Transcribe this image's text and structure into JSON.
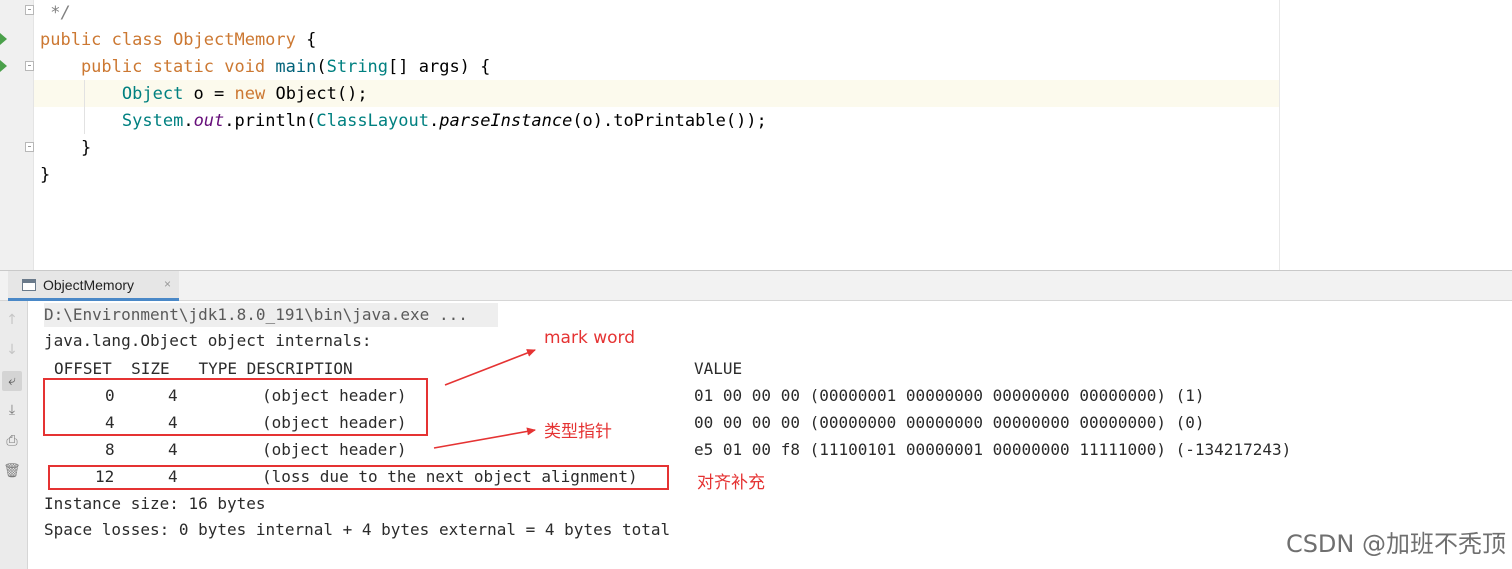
{
  "editor": {
    "lines": [
      {
        "segments": [
          {
            "t": " */",
            "c": "cmt"
          }
        ]
      },
      {
        "segments": [
          {
            "t": "public class ",
            "c": "orange"
          },
          {
            "t": "ObjectMemory",
            "c": "orange"
          },
          {
            "t": " {",
            "c": ""
          }
        ]
      },
      {
        "segments": [
          {
            "t": "    public static void ",
            "c": "orange"
          },
          {
            "t": "main",
            "c": "fn"
          },
          {
            "t": "(",
            "c": ""
          },
          {
            "t": "String",
            "c": "cls"
          },
          {
            "t": "[] args) {",
            "c": ""
          }
        ]
      },
      {
        "segments": [
          {
            "t": "        ",
            "c": ""
          },
          {
            "t": "Object",
            "c": "cls"
          },
          {
            "t": " o = ",
            "c": ""
          },
          {
            "t": "new ",
            "c": "orange"
          },
          {
            "t": "Object();",
            "c": ""
          }
        ]
      },
      {
        "segments": [
          {
            "t": "        ",
            "c": ""
          },
          {
            "t": "System",
            "c": "cls"
          },
          {
            "t": ".",
            "c": ""
          },
          {
            "t": "out",
            "c": "it"
          },
          {
            "t": ".println(",
            "c": ""
          },
          {
            "t": "ClassLayout",
            "c": "cls"
          },
          {
            "t": ".",
            "c": ""
          },
          {
            "t": "parseInstance",
            "c": "it2"
          },
          {
            "t": "(o).toPrintable());",
            "c": ""
          }
        ]
      },
      {
        "segments": [
          {
            "t": "    }",
            "c": ""
          }
        ]
      },
      {
        "segments": [
          {
            "t": "}",
            "c": ""
          }
        ]
      }
    ]
  },
  "run_panel": {
    "tab_label": "ObjectMemory",
    "tab_close": "×",
    "toolbar": [
      {
        "name": "up-arrow-icon",
        "glyph": "↑"
      },
      {
        "name": "down-arrow-icon",
        "glyph": "↓"
      },
      {
        "name": "soft-wrap-icon",
        "glyph": "⤶"
      },
      {
        "name": "scroll-to-end-icon",
        "glyph": "⤓"
      },
      {
        "name": "print-icon",
        "glyph": "⎙"
      },
      {
        "name": "trash-icon",
        "glyph": "🗑"
      }
    ]
  },
  "console": {
    "command": "D:\\Environment\\jdk1.8.0_191\\bin\\java.exe ...",
    "header_line": "java.lang.Object object internals:",
    "columns": "OFFSET  SIZE   TYPE DESCRIPTION",
    "value_header": "VALUE",
    "rows": [
      {
        "offset": "0",
        "size": "4",
        "desc": "(object header)",
        "value": "01 00 00 00 (00000001 00000000 00000000 00000000) (1)"
      },
      {
        "offset": "4",
        "size": "4",
        "desc": "(object header)",
        "value": "00 00 00 00 (00000000 00000000 00000000 00000000) (0)"
      },
      {
        "offset": "8",
        "size": "4",
        "desc": "(object header)",
        "value": "e5 01 00 f8 (11100101 00000001 00000000 11111000) (-134217243)"
      },
      {
        "offset": "12",
        "size": "4",
        "desc": "(loss due to the next object alignment)",
        "value": ""
      }
    ],
    "instance_size": "Instance size: 16 bytes",
    "space_losses": "Space losses: 0 bytes internal + 4 bytes external = 4 bytes total"
  },
  "annotations": {
    "mark_word": "mark word",
    "type_pointer": "类型指针",
    "padding": "对齐补充",
    "color": "#e53333"
  },
  "watermark": "CSDN @加班不秃顶"
}
